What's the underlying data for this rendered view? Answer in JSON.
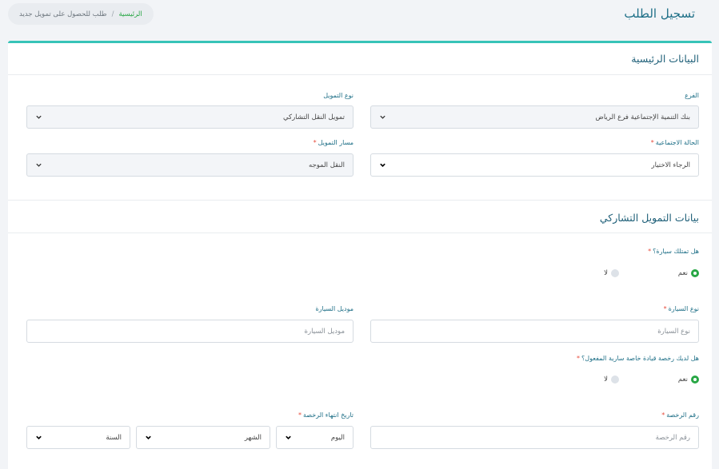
{
  "header": {
    "title": "تسجيل الطلب",
    "breadcrumb": {
      "home": "الرئيسية",
      "separator": "/",
      "current": "طلب للحصول على تمويل جديد"
    }
  },
  "main_section": {
    "title": "البيانات الرئيسية",
    "branch": {
      "label": "الفرع",
      "value": "بنك التنمية الإجتماعية فرع الرياض"
    },
    "financing_type": {
      "label": "نوع التمويل",
      "value": "تمويل النقل التشاركي"
    },
    "social_status": {
      "label": "الحالة الاجتماعية",
      "required": "*",
      "value": "الرجاء الاختيار"
    },
    "financing_track": {
      "label": "مسار التمويل",
      "required": "*",
      "value": "النقل الموجه"
    }
  },
  "sharing_section": {
    "title": "بيانات التمويل التشاركي",
    "own_car": {
      "label": "هل تمتلك سيارة؟",
      "required": "*",
      "yes": "نعم",
      "no": "لا"
    },
    "car_type": {
      "label": "نوع السيارة",
      "required": "*",
      "placeholder": "نوع السيارة"
    },
    "car_model": {
      "label": "موديل السيارة",
      "placeholder": "موديل السيارة"
    },
    "license": {
      "label": "هل لديك رخصة قيادة خاصة سارية المفعول؟",
      "required": "*",
      "yes": "نعم",
      "no": "لا"
    },
    "license_number": {
      "label": "رقم الرخصة",
      "required": "*",
      "placeholder": "رقم الرخصة"
    },
    "license_expiry": {
      "label": "تاريخ انتهاء الرخصة",
      "required": "*",
      "day": "اليوم",
      "month": "الشهر",
      "year": "السنة"
    }
  },
  "colors": {
    "accent": "#37c3b8",
    "title": "#1e6f87",
    "radio_on": "#28a745",
    "required": "#e74c3c"
  },
  "icons": {
    "select": "chevron-down-icon",
    "radio_selected": "radio-selected-icon",
    "radio_unselected": "radio-unselected-icon"
  }
}
